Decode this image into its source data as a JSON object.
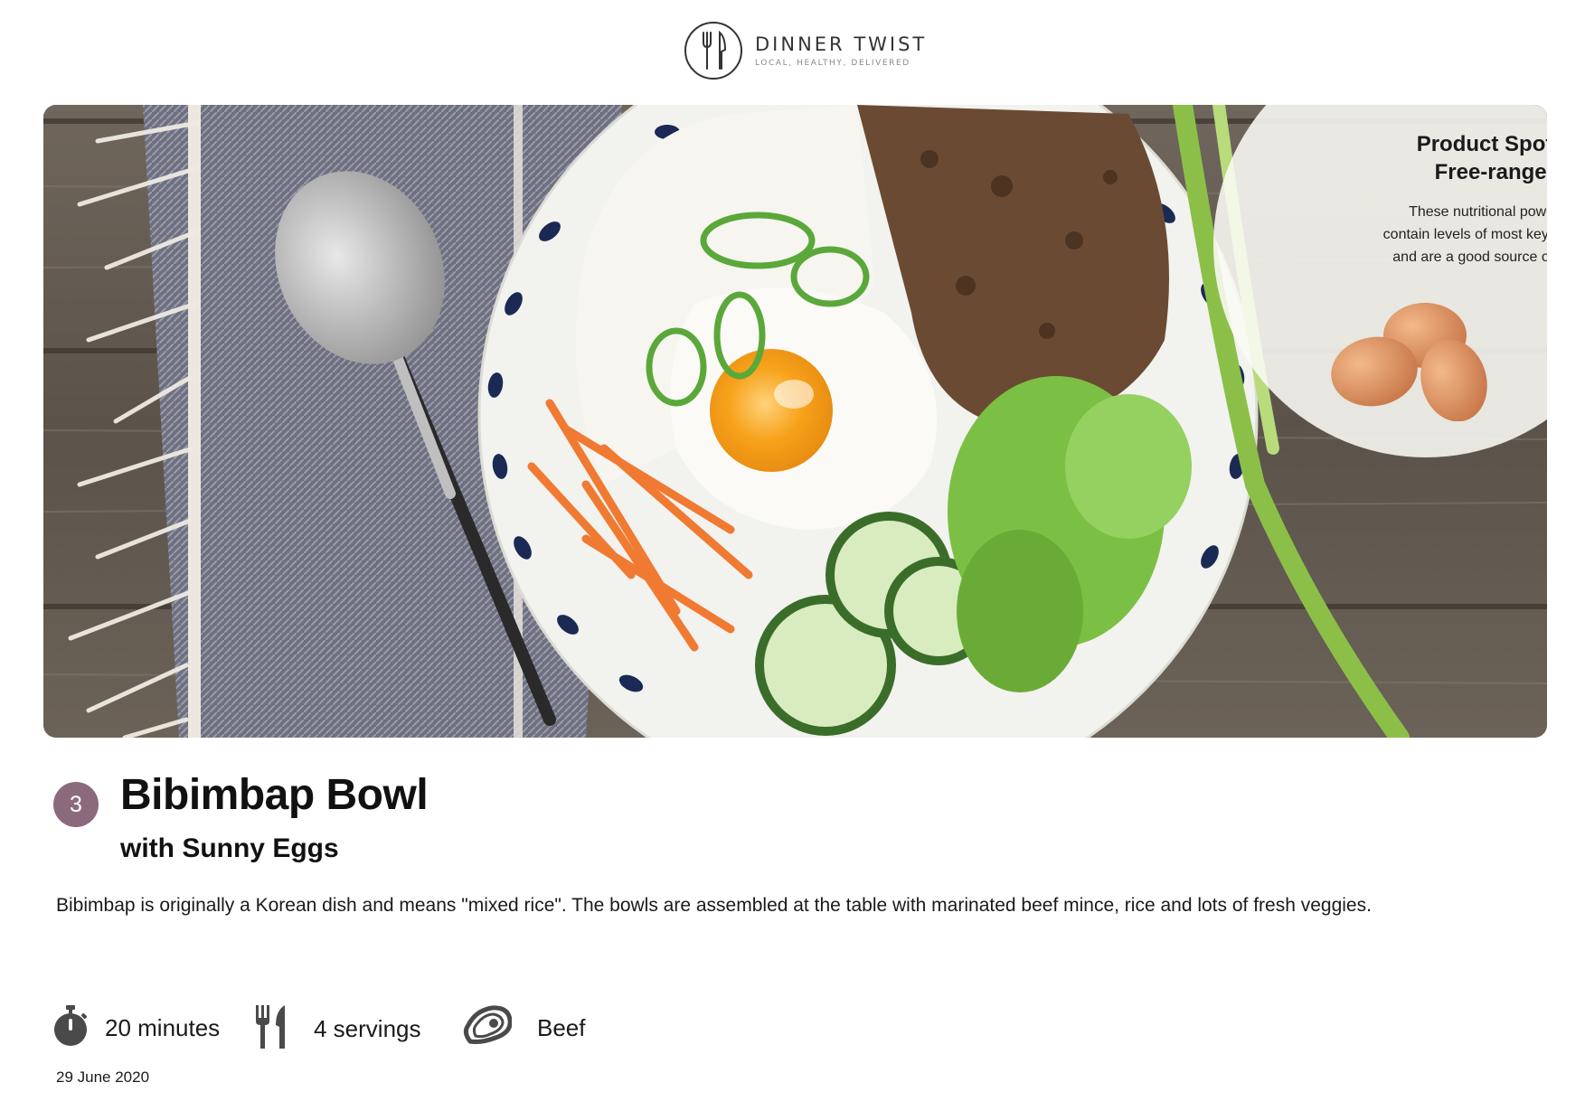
{
  "brand": {
    "name": "DINNER TWIST",
    "tagline": "LOCAL, HEALTHY, DELIVERED"
  },
  "spotlight": {
    "title_line1": "Product Spotlight:",
    "title_line2": "Free-range Eggs",
    "body_line1": "These nutritional powerhouses",
    "body_line2": "contain levels of most key vitamins",
    "body_line3": "and are a good source of protein."
  },
  "recipe": {
    "number": "3",
    "title": "Bibimbap Bowl",
    "subtitle": "with Sunny Eggs",
    "description": "Bibimbap is originally a Korean dish and means \"mixed rice\". The bowls are assembled at the table with marinated beef mince, rice and lots of fresh veggies.",
    "time": "20 minutes",
    "servings": "4 servings",
    "protein": "Beef",
    "date": "29 June 2020"
  },
  "icons": {
    "logo": "fork-knife-icon",
    "time": "stopwatch-icon",
    "servings": "utensils-icon",
    "protein": "steak-icon"
  },
  "colors": {
    "badge": "#8c6a7e",
    "icon": "#4a4a4a"
  }
}
